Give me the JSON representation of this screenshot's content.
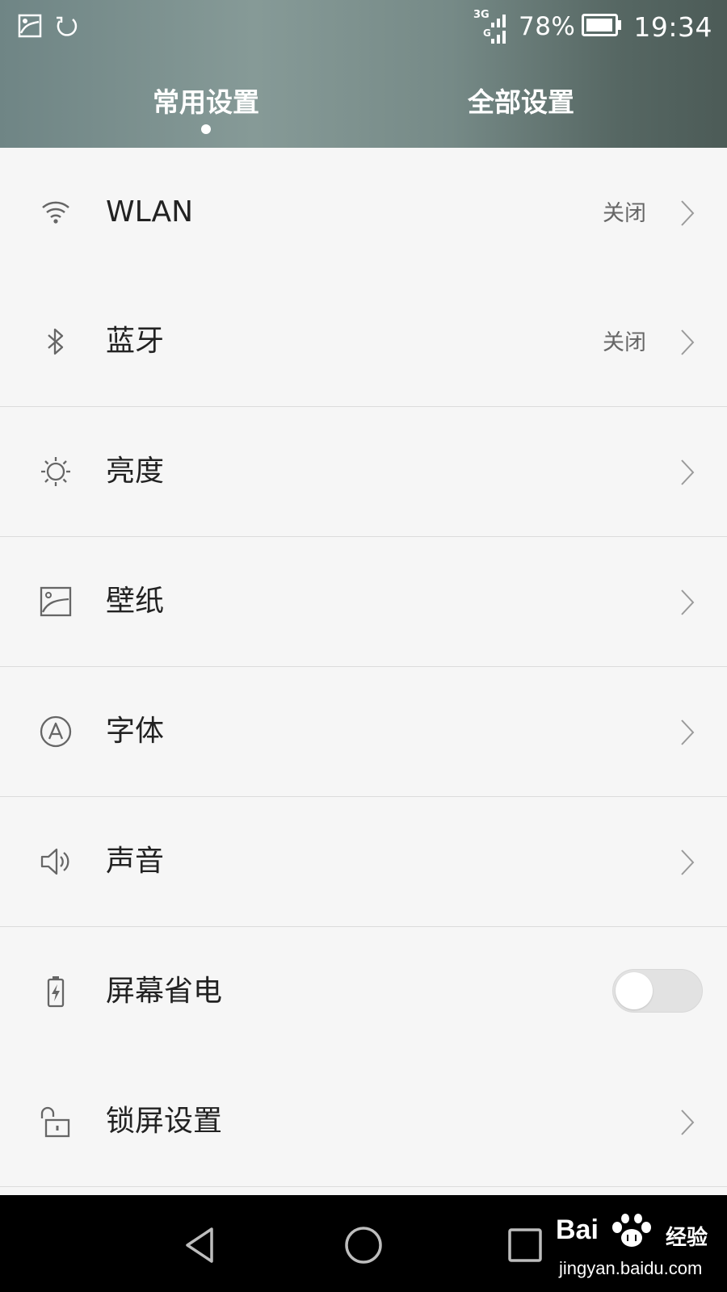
{
  "status_bar": {
    "network_top": "3G",
    "network_bottom": "G",
    "battery_percent": "78%",
    "time": "19:34"
  },
  "tabs": [
    {
      "label": "常用设置",
      "active": true
    },
    {
      "label": "全部设置",
      "active": false
    }
  ],
  "settings": [
    {
      "label": "WLAN",
      "value": "关闭",
      "icon": "wifi-icon"
    },
    {
      "label": "蓝牙",
      "value": "关闭",
      "icon": "bluetooth-icon"
    },
    {
      "label": "亮度",
      "icon": "brightness-icon"
    },
    {
      "label": "壁纸",
      "icon": "wallpaper-icon"
    },
    {
      "label": "字体",
      "icon": "font-icon"
    },
    {
      "label": "声音",
      "icon": "speaker-icon"
    },
    {
      "label": "屏幕省电",
      "icon": "battery-saver-icon",
      "toggle_on": false
    },
    {
      "label": "锁屏设置",
      "icon": "unlock-icon"
    }
  ],
  "watermark": {
    "brand": "Bai",
    "brand_suffix": "经验",
    "url": "jingyan.baidu.com"
  },
  "colors": {
    "header_gradient_start": "#6f8585",
    "header_gradient_end": "#4c5b57",
    "list_background": "#f6f6f6",
    "divider": "#dcdcdc",
    "nav_background": "#000000"
  }
}
